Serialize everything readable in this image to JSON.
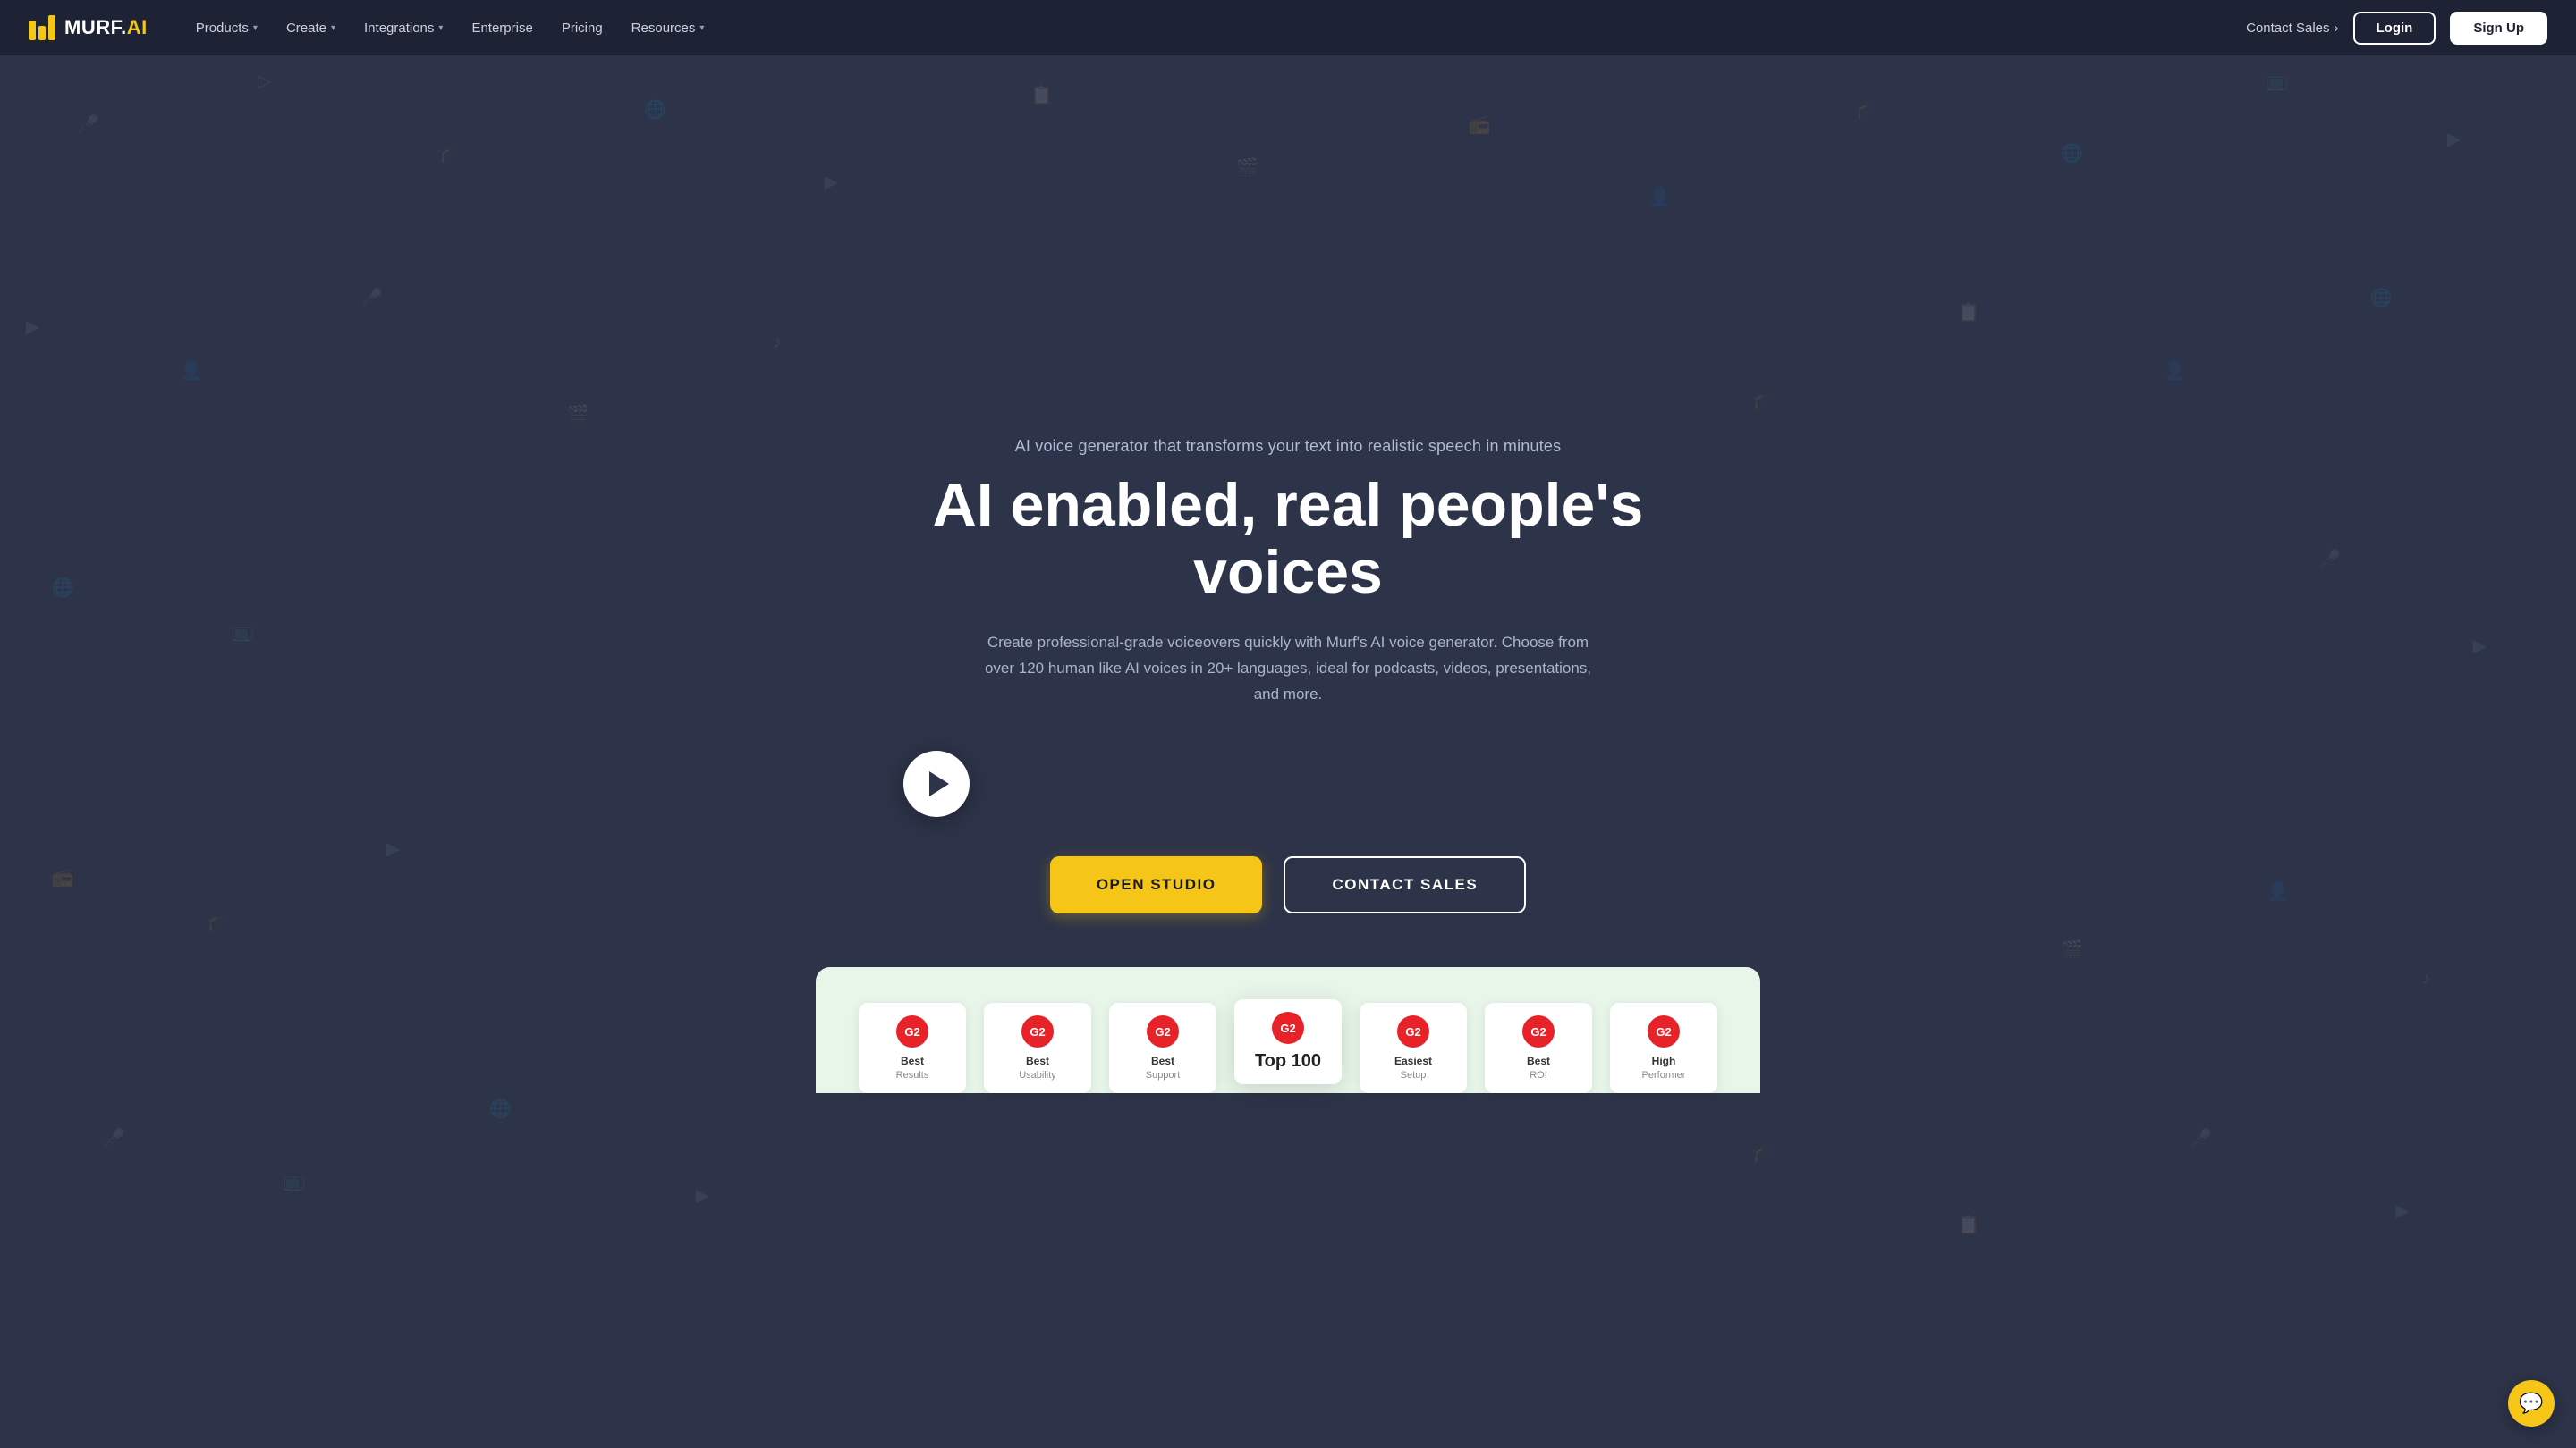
{
  "logo": {
    "text": "MURF",
    "accent": "AI",
    "full": "MURF.AI"
  },
  "nav": {
    "links": [
      {
        "label": "Products",
        "hasDropdown": true
      },
      {
        "label": "Create",
        "hasDropdown": true
      },
      {
        "label": "Integrations",
        "hasDropdown": true
      },
      {
        "label": "Enterprise",
        "hasDropdown": false
      },
      {
        "label": "Pricing",
        "hasDropdown": false
      },
      {
        "label": "Resources",
        "hasDropdown": true
      }
    ],
    "contact_sales": "Contact Sales",
    "login": "Login",
    "signup": "Sign Up"
  },
  "hero": {
    "subtitle": "AI voice generator that transforms your text into realistic speech in minutes",
    "title": "AI enabled, real people's voices",
    "description": "Create professional-grade voiceovers quickly with Murf's AI voice generator. Choose from over 120 human like AI voices in 20+ languages, ideal for podcasts, videos, presentations, and more.",
    "btn_open_studio": "OPEN STUDIO",
    "btn_contact_sales": "CONTACT SALES"
  },
  "awards": [
    {
      "badge": "G2",
      "title": "Best",
      "subtitle": "Results",
      "featured": false
    },
    {
      "badge": "G2",
      "title": "Best",
      "subtitle": "Usability",
      "featured": false
    },
    {
      "badge": "G2",
      "title": "Best",
      "subtitle": "Support",
      "featured": false
    },
    {
      "badge": "G2",
      "big_title": "Top 100",
      "featured": true
    },
    {
      "badge": "G2",
      "title": "Easiest",
      "subtitle": "Setup",
      "featured": false
    },
    {
      "badge": "G2",
      "title": "Best",
      "subtitle": "ROI",
      "featured": false
    },
    {
      "badge": "G2",
      "title": "High",
      "subtitle": "Performer",
      "featured": false
    }
  ],
  "colors": {
    "bg_dark": "#2d3348",
    "nav_bg": "#1e2235",
    "yellow": "#f5c518",
    "white": "#ffffff"
  }
}
